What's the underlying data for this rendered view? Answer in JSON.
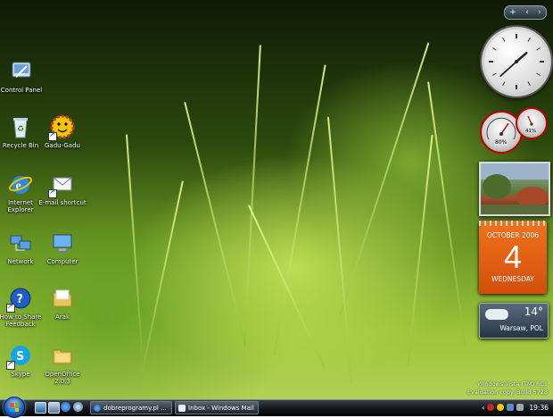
{
  "desktop": {
    "icons": [
      {
        "label": "Control Panel",
        "icon": "control-panel-icon"
      },
      {
        "label": "Recycle Bin",
        "icon": "recycle-bin-icon"
      },
      {
        "label": "Gadu-Gadu",
        "icon": "gadu-gadu-icon"
      },
      {
        "label": "Internet Explorer",
        "icon": "internet-explorer-icon"
      },
      {
        "label": "E-mail shortcut",
        "icon": "email-icon"
      },
      {
        "label": "Network",
        "icon": "network-icon"
      },
      {
        "label": "Computer",
        "icon": "computer-icon"
      },
      {
        "label": "How to Share Feedback",
        "icon": "help-icon"
      },
      {
        "label": "Arak",
        "icon": "folder-icon"
      },
      {
        "label": "Skype",
        "icon": "skype-icon"
      },
      {
        "label": "OpenOffice 2.0.3",
        "icon": "folder-icon"
      }
    ]
  },
  "sidebar": {
    "controls": [
      "+",
      "‹",
      "›"
    ],
    "cpu": {
      "cpu_percent": "80%",
      "mem_percent": "41%"
    },
    "calendar": {
      "month": "OCTOBER 2006",
      "day": "4",
      "weekday": "WEDNESDAY"
    },
    "weather": {
      "temp": "14°",
      "city": "Warsaw, POL"
    },
    "clock": {
      "hour": 1,
      "minute": 38
    }
  },
  "watermark": {
    "line1": "Windows Vista (TM) RC1",
    "line2": "Evaluation copy. Build 5728"
  },
  "taskbar": {
    "tasks": [
      {
        "label": "dobreprogramy.pl ...",
        "icon": "internet-explorer-icon"
      },
      {
        "label": "Inbox - Windows Mail",
        "icon": "mail-icon"
      }
    ],
    "clock": "19:36"
  },
  "colors": {
    "calendar_orange": "#e2601a",
    "taskbar": "#15191e",
    "start_orb": "#1c62c4"
  }
}
